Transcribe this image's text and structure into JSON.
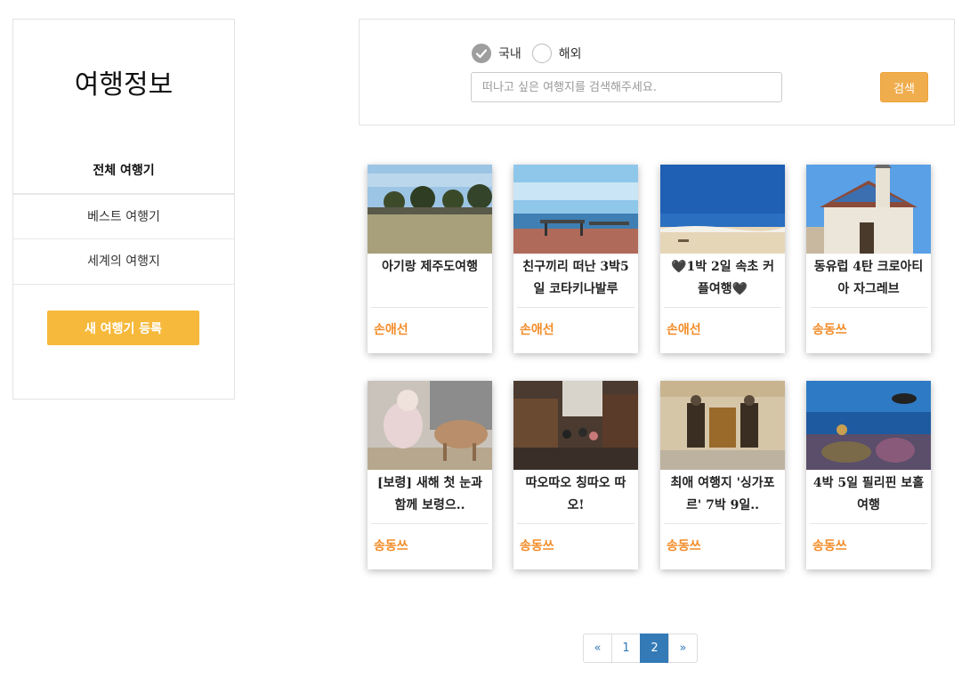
{
  "sidebar": {
    "title": "여행정보",
    "nav": [
      {
        "label": "전체 여행기",
        "active": true
      },
      {
        "label": "베스트 여행기",
        "active": false
      },
      {
        "label": "세계의 여행지",
        "active": false
      }
    ],
    "new_post_label": "새 여행기 등록"
  },
  "search": {
    "radio_domestic": "국내",
    "radio_overseas": "해외",
    "selected": "국내",
    "placeholder": "떠나고 싶은 여행지를 검색해주세요.",
    "value": "",
    "button_label": "검색"
  },
  "cards": [
    {
      "title": "아기랑 제주도여행",
      "author": "손애선",
      "image": "field-trees-sky"
    },
    {
      "title": "친구끼리 떠난 3박5일 코타키나발루",
      "author": "손애선",
      "image": "seaside-deck"
    },
    {
      "title": "🖤1박 2일 속초 커플여행🖤",
      "author": "손애선",
      "image": "blue-sea-beach"
    },
    {
      "title": "동유럽 4탄 크로아티아 자그레브",
      "author": "송동쓰",
      "image": "zagreb-church"
    },
    {
      "title": "[보령] 새해 첫 눈과 함께 보령으..",
      "author": "송동쓰",
      "image": "person-feeding-animal"
    },
    {
      "title": "따오따오 칭따오 따오!",
      "author": "송동쓰",
      "image": "market-street"
    },
    {
      "title": "최애 여행지 '싱가포르' 7박 9일..",
      "author": "송동쓰",
      "image": "temple-statues"
    },
    {
      "title": "4박 5일 필리핀 보홀 여행",
      "author": "송동쓰",
      "image": "underwater-diver"
    }
  ],
  "pagination": {
    "prev": "«",
    "pages": [
      "1",
      "2"
    ],
    "current": "2",
    "next": "»"
  },
  "colors": {
    "accent": "#f6b93b",
    "search_button": "#f0ad4e",
    "author": "#f28c28",
    "page_active": "#337ab7"
  }
}
